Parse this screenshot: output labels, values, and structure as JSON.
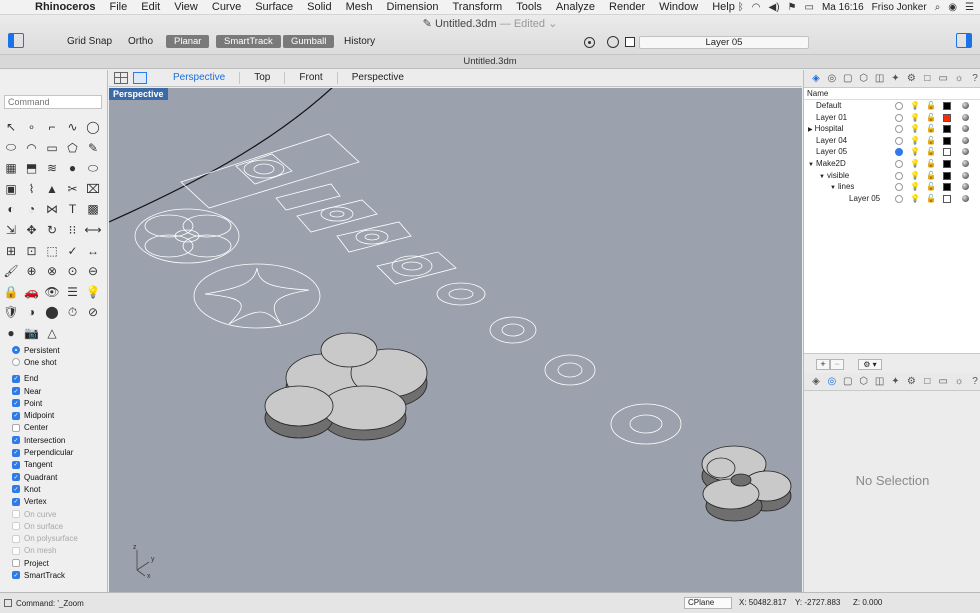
{
  "menubar": {
    "items": [
      "Rhinoceros",
      "File",
      "Edit",
      "View",
      "Curve",
      "Surface",
      "Solid",
      "Mesh",
      "Dimension",
      "Transform",
      "Tools",
      "Analyze",
      "Render",
      "Window",
      "Help"
    ],
    "clock": "Ma 16:16",
    "user": "Friso Jonker"
  },
  "window": {
    "title": "Untitled.3dm",
    "edited": "— Edited ⌄",
    "doc_tab": "Untitled.3dm"
  },
  "toolbar": {
    "grid_snap": "Grid Snap",
    "ortho": "Ortho",
    "planar": "Planar",
    "smarttrack": "SmartTrack",
    "gumball": "Gumball",
    "history": "History",
    "current_layer": "Layer 05"
  },
  "command": {
    "placeholder": "Command"
  },
  "tools": [
    "arrow-pointer-icon",
    "point-icon",
    "polyline-icon",
    "curve-icon",
    "circle-tool-icon",
    "ellipse-tool-icon",
    "arc-icon",
    "rectangle-icon",
    "polygon-icon",
    "freeform-icon",
    "surface-icon",
    "extrude-icon",
    "loft-icon",
    "sphere-icon",
    "cylinder-icon",
    "box-icon",
    "pipe-icon",
    "cone-icon",
    "split-icon",
    "trim-icon",
    "boolean-icon",
    "fillet-icon",
    "blend-icon",
    "text-icon",
    "mesh-icon",
    "transform-icon",
    "move-icon",
    "rotate-icon",
    "array-icon",
    "mirror-icon",
    "grid-tool-icon",
    "group-icon",
    "block-icon",
    "check-icon",
    "dimension-icon",
    "paint-icon",
    "zoom-in-icon",
    "zoom-window-icon",
    "zoom-extents-icon",
    "zoom-out-icon",
    "lock-icon",
    "car-icon",
    "show-icon",
    "layer-tool-icon",
    "light-icon",
    "material-icon",
    "render-icon",
    "color-wheel-icon",
    "history-icon",
    "section-icon",
    "sphere-render-icon",
    "camera-icon",
    "triangle-icon"
  ],
  "snaps": {
    "modes": [
      {
        "label": "Persistent",
        "on": true
      },
      {
        "label": "One shot",
        "on": false
      }
    ],
    "items": [
      {
        "label": "End",
        "on": true,
        "disabled": false
      },
      {
        "label": "Near",
        "on": true,
        "disabled": false
      },
      {
        "label": "Point",
        "on": true,
        "disabled": false
      },
      {
        "label": "Midpoint",
        "on": true,
        "disabled": false
      },
      {
        "label": "Center",
        "on": false,
        "disabled": false
      },
      {
        "label": "Intersection",
        "on": true,
        "disabled": false
      },
      {
        "label": "Perpendicular",
        "on": true,
        "disabled": false
      },
      {
        "label": "Tangent",
        "on": true,
        "disabled": false
      },
      {
        "label": "Quadrant",
        "on": true,
        "disabled": false
      },
      {
        "label": "Knot",
        "on": true,
        "disabled": false
      },
      {
        "label": "Vertex",
        "on": true,
        "disabled": false
      },
      {
        "label": "On curve",
        "on": false,
        "disabled": true
      },
      {
        "label": "On surface",
        "on": false,
        "disabled": true
      },
      {
        "label": "On polysurface",
        "on": false,
        "disabled": true
      },
      {
        "label": "On mesh",
        "on": false,
        "disabled": true
      },
      {
        "label": "Project",
        "on": false,
        "disabled": false
      },
      {
        "label": "SmartTrack",
        "on": true,
        "disabled": false
      }
    ]
  },
  "viewport": {
    "tabs": [
      "Perspective",
      "Top",
      "Front",
      "Perspective"
    ],
    "label": "Perspective",
    "axis": {
      "z": "z",
      "y": "y",
      "x": "x"
    }
  },
  "layers": {
    "header": "Name",
    "rows": [
      {
        "name": "Default",
        "indent": 0,
        "expander": "",
        "current": false,
        "visible": false,
        "color": "#000000"
      },
      {
        "name": "Layer 01",
        "indent": 0,
        "expander": "",
        "current": false,
        "visible": false,
        "color": "#ff2a00"
      },
      {
        "name": "Hospital",
        "indent": 0,
        "expander": "▶",
        "current": false,
        "visible": true,
        "color": "#000000"
      },
      {
        "name": "Layer 04",
        "indent": 0,
        "expander": "",
        "current": false,
        "visible": true,
        "color": "#000000"
      },
      {
        "name": "Layer 05",
        "indent": 0,
        "expander": "",
        "current": true,
        "visible": false,
        "color": "#ffffff"
      },
      {
        "name": "Make2D",
        "indent": 0,
        "expander": "▼",
        "current": false,
        "visible": true,
        "color": "#000000"
      },
      {
        "name": "visible",
        "indent": 1,
        "expander": "▼",
        "current": false,
        "visible": true,
        "color": "#000000"
      },
      {
        "name": "lines",
        "indent": 2,
        "expander": "▼",
        "current": false,
        "visible": true,
        "color": "#000000"
      },
      {
        "name": "Layer 05",
        "indent": 3,
        "expander": "",
        "current": false,
        "visible": true,
        "color": "#ffffff"
      }
    ]
  },
  "properties": {
    "empty": "No Selection"
  },
  "status": {
    "command": "Command: '_Zoom",
    "cplane": "CPlane",
    "x": "X: 50482.817",
    "y": "Y: -2727.883",
    "z": "Z: 0.000"
  },
  "colors": {
    "accent": "#2e7be8",
    "viewport_bg": "#9ba2ad",
    "viewport_label": "#3b6aa8"
  }
}
